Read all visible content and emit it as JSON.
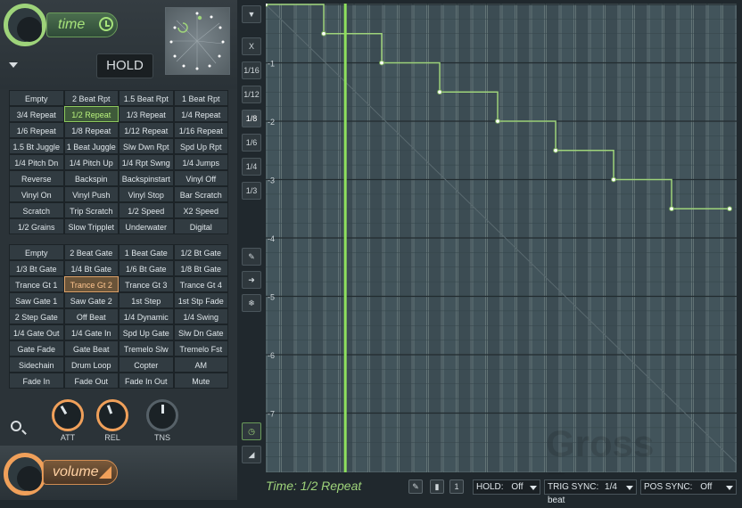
{
  "time_section": {
    "label": "time",
    "hold_label": "HOLD"
  },
  "time_presets": [
    "Empty",
    "2 Beat Rpt",
    "1.5 Beat Rpt",
    "1 Beat Rpt",
    "3/4 Repeat",
    "1/2 Repeat",
    "1/3 Repeat",
    "1/4 Repeat",
    "1/6 Repeat",
    "1/8 Repeat",
    "1/12 Repeat",
    "1/16 Repeat",
    "1.5 Bt Juggle",
    "1 Beat Juggle",
    "Slw Dwn Rpt",
    "Spd Up Rpt",
    "1/4 Pitch Dn",
    "1/4 Pitch Up",
    "1/4 Rpt Swng",
    "1/4 Jumps",
    "Reverse",
    "Backspin",
    "Backspinstart",
    "Vinyl Off",
    "Vinyl On",
    "Vinyl Push",
    "Vinyl Stop",
    "Bar Scratch",
    "Scratch",
    "Trip Scratch",
    "1/2 Speed",
    "X2 Speed",
    "1/2 Grains",
    "Slow Tripplet",
    "Underwater",
    "Digital"
  ],
  "time_selected": "1/2 Repeat",
  "volume_presets": [
    "Empty",
    "2 Beat Gate",
    "1 Beat Gate",
    "1/2 Bt Gate",
    "1/3 Bt Gate",
    "1/4 Bt Gate",
    "1/6 Bt Gate",
    "1/8 Bt Gate",
    "Trance Gt 1",
    "Trance Gt 2",
    "Trance Gt 3",
    "Trance Gt 4",
    "Saw Gate 1",
    "Saw Gate 2",
    "1st Step",
    "1st Stp Fade",
    "2 Step Gate",
    "Off Beat",
    "1/4 Dynamic",
    "1/4 Swing",
    "1/4 Gate Out",
    "1/4 Gate In",
    "Spd Up Gate",
    "Slw Dn Gate",
    "Gate Fade",
    "Gate Beat",
    "Tremelo Slw",
    "Tremelo Fst",
    "Sidechain",
    "Drum Loop",
    "Copter",
    "AM",
    "Fade In",
    "Fade Out",
    "Fade In Out",
    "Mute"
  ],
  "volume_selected": "Trance Gt 2",
  "knobs": {
    "att": "ATT",
    "rel": "REL",
    "tns": "TNS"
  },
  "volume_section": {
    "label": "volume"
  },
  "side_tools": {
    "x": "X",
    "r1_16": "1/16",
    "r1_12": "1/12",
    "r1_8": "1/8",
    "r1_6": "1/6",
    "r1_4": "1/4",
    "r1_3": "1/3"
  },
  "y_axis_labels": [
    "-1",
    "-2",
    "-3",
    "-4",
    "-5",
    "-6",
    "-7"
  ],
  "envelope_steps": [
    {
      "x": 0,
      "y": 0
    },
    {
      "x": 1,
      "y": -0.5
    },
    {
      "x": 2,
      "y": -1
    },
    {
      "x": 3,
      "y": -1.5
    },
    {
      "x": 4,
      "y": -2
    },
    {
      "x": 5,
      "y": -2.5
    },
    {
      "x": 6,
      "y": -3
    },
    {
      "x": 7,
      "y": -3.5
    },
    {
      "x": 8,
      "y": -3.5
    }
  ],
  "playhead_position": 2.65,
  "status_text": "Time: 1/2 Repeat",
  "bottom": {
    "hold_label": "HOLD:",
    "hold_value": "Off",
    "trig_label": "TRIG SYNC:",
    "trig_value": "1/4 beat",
    "pos_label": "POS SYNC:",
    "pos_value": "Off"
  },
  "watermark": "Gross Beat",
  "colors": {
    "accent_green": "#9ed37a",
    "accent_orange": "#f0a05a",
    "grid_bg": "#3e4f56"
  }
}
